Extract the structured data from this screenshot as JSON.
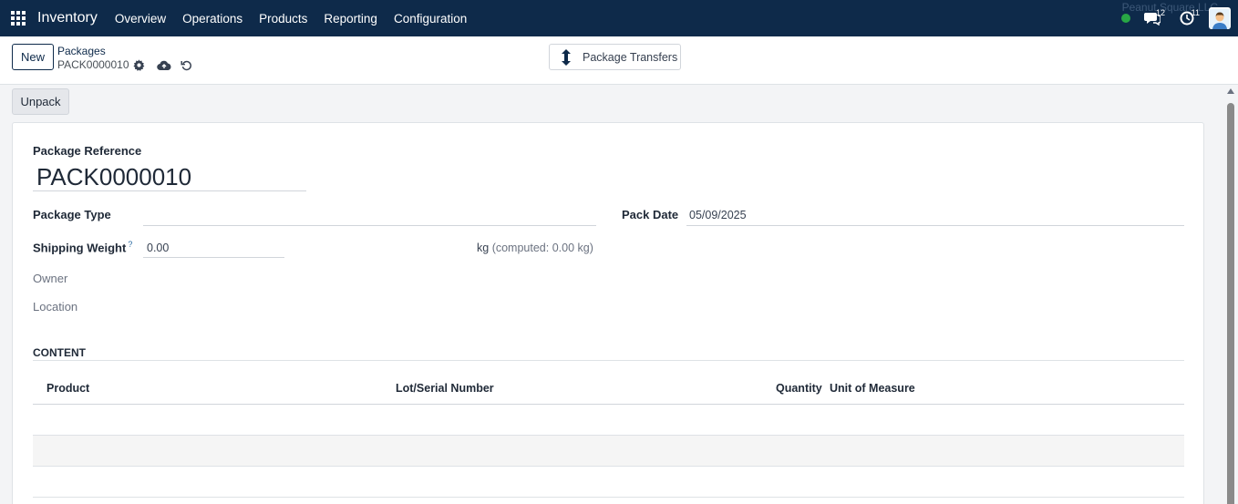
{
  "navbar": {
    "app_name": "Inventory",
    "menu": [
      "Overview",
      "Operations",
      "Products",
      "Reporting",
      "Configuration"
    ],
    "messages_count": "12",
    "activities_count": "11",
    "company": "Peanut Square LLC"
  },
  "control_panel": {
    "new_label": "New",
    "breadcrumb": "Packages",
    "record_name": "PACK0000010",
    "smart_button_label": "Package Transfers"
  },
  "actions": {
    "unpack_label": "Unpack"
  },
  "form": {
    "package_reference_label": "Package Reference",
    "package_reference_value": "PACK0000010",
    "package_type_label": "Package Type",
    "package_type_value": "",
    "pack_date_label": "Pack Date",
    "pack_date_value": "05/09/2025",
    "shipping_weight_label": "Shipping Weight",
    "shipping_weight_help": "?",
    "shipping_weight_value": "0.00",
    "weight_unit": "kg",
    "computed_weight": "(computed: 0.00 kg)",
    "owner_label": "Owner",
    "location_label": "Location"
  },
  "content": {
    "section_title": "CONTENT",
    "columns": [
      "Product",
      "Lot/Serial Number",
      "Quantity",
      "Unit of Measure"
    ]
  },
  "colors": {
    "navbar_bg": "#0e2a4a",
    "presence": "#28a745"
  }
}
